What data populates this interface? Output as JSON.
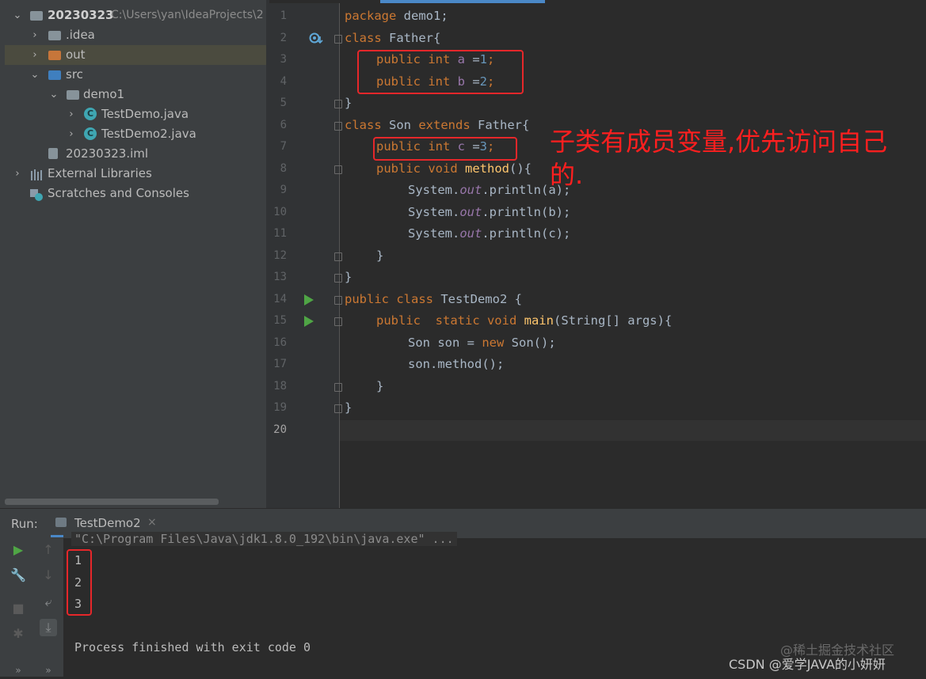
{
  "project": {
    "root_name": "20230323",
    "root_path": "C:\\Users\\yan\\IdeaProjects\\2",
    "items": [
      {
        "label": ".idea"
      },
      {
        "label": "out"
      },
      {
        "label": "src"
      },
      {
        "label": "demo1"
      },
      {
        "label": "TestDemo.java"
      },
      {
        "label": "TestDemo2.java"
      },
      {
        "label": "20230323.iml"
      },
      {
        "label": "External Libraries"
      },
      {
        "label": "Scratches and Consoles"
      }
    ]
  },
  "editor": {
    "line_numbers": [
      "1",
      "2",
      "3",
      "4",
      "5",
      "6",
      "7",
      "8",
      "9",
      "10",
      "11",
      "12",
      "13",
      "14",
      "15",
      "16",
      "17",
      "18",
      "19",
      "20"
    ],
    "code": {
      "l1_kw": "package",
      "l1_rest": " demo1;",
      "l2_kw": "class",
      "l2_rest": " Father{",
      "l3_kw": "public int",
      "l3_var": " a ",
      "l3_eq": "=",
      "l3_num": "1",
      "l3_end": ";",
      "l4_kw": "public int",
      "l4_var": " b ",
      "l4_eq": "=",
      "l4_num": "2",
      "l4_end": ";",
      "l5": "}",
      "l6_kw": "class",
      "l6_name": " Son ",
      "l6_kw2": "extends",
      "l6_rest": " Father{",
      "l7_kw": "public int",
      "l7_var": " c ",
      "l7_eq": "=",
      "l7_num": "3",
      "l7_end": ";",
      "l8_kw": "public void",
      "l8_fn": " method",
      "l8_rest": "(){",
      "l9_a": "System.",
      "l9_out": "out",
      "l9_b": ".println(a);",
      "l10_a": "System.",
      "l10_out": "out",
      "l10_b": ".println(b);",
      "l11_a": "System.",
      "l11_out": "out",
      "l11_b": ".println(c);",
      "l12": "}",
      "l13": "}",
      "l14_kw": "public class",
      "l14_rest": " TestDemo2 {",
      "l15_kw": "public  static void",
      "l15_fn": " main",
      "l15_rest": "(String[] args){",
      "l16_a": "Son son = ",
      "l16_kw": "new",
      "l16_b": " Son();",
      "l17": "son.method();",
      "l18": "}",
      "l19": "}"
    },
    "annotation": "子类有成员变量,优先访问自己的."
  },
  "run": {
    "title": "Run:",
    "tab_label": "TestDemo2",
    "close_glyph": "×",
    "command": "\"C:\\Program Files\\Java\\jdk1.8.0_192\\bin\\java.exe\" ...",
    "outputs": [
      "1",
      "2",
      "3"
    ],
    "finish": "Process finished with exit code 0"
  },
  "watermark": {
    "line1": "@稀土掘金技术社区",
    "line2": "CSDN @爱学JAVA的小妍妍"
  },
  "colors": {
    "keyword": "#cc7832",
    "function": "#ffc66d",
    "number": "#6897bb",
    "field": "#9876aa",
    "annotation": "#ff1f1f"
  }
}
